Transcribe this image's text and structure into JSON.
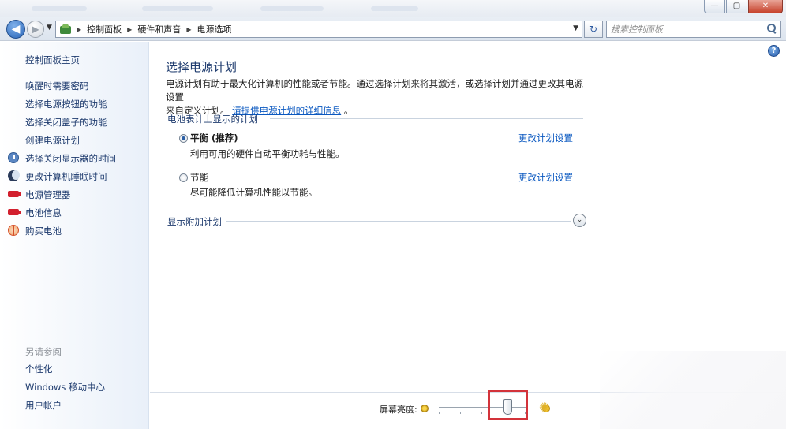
{
  "window": {
    "minimize_glyph": "—",
    "maximize_glyph": "▢",
    "close_glyph": "✕"
  },
  "nav": {
    "back_glyph": "◀",
    "forward_glyph": "▶",
    "dropdown_glyph": "▼",
    "breadcrumbs": [
      "控制面板",
      "硬件和声音",
      "电源选项"
    ],
    "breadcrumb_separator": "▶",
    "refresh_glyph": "↻",
    "search_placeholder": "搜索控制面板"
  },
  "sidebar": {
    "home": "控制面板主页",
    "links": [
      {
        "label": "唤醒时需要密码",
        "icon": ""
      },
      {
        "label": "选择电源按钮的功能",
        "icon": ""
      },
      {
        "label": "选择关闭盖子的功能",
        "icon": ""
      },
      {
        "label": "创建电源计划",
        "icon": ""
      },
      {
        "label": "选择关闭显示器的时间",
        "icon": "display-clock-icon"
      },
      {
        "label": "更改计算机睡眠时间",
        "icon": "moon-icon"
      },
      {
        "label": "电源管理器",
        "icon": "battery-icon"
      },
      {
        "label": "电池信息",
        "icon": "battery-icon"
      },
      {
        "label": "购买电池",
        "icon": "globe-icon"
      }
    ],
    "see_also_title": "另请参阅",
    "see_also": [
      "个性化",
      "Windows 移动中心",
      "用户帐户"
    ]
  },
  "main": {
    "help_glyph": "?",
    "title": "选择电源计划",
    "description_line1": "电源计划有助于最大化计算机的性能或者节能。通过选择计划来将其激活，或选择计划并通过更改其电源设置",
    "description_line2_prefix": "来自定义计划。",
    "description_link": "请提供电源计划的详细信息",
    "description_line2_suffix": "。",
    "section_label": "电池表计上显示的计划",
    "plans": [
      {
        "name": "平衡 (推荐)",
        "description": "利用可用的硬件自动平衡功耗与性能。",
        "selected": true,
        "link": "更改计划设置"
      },
      {
        "name": "节能",
        "description": "尽可能降低计算机性能以节能。",
        "selected": false,
        "link": "更改计划设置"
      }
    ],
    "more_plans_label": "显示附加计划",
    "expand_glyph": "⌄"
  },
  "brightness": {
    "label": "屏幕亮度:",
    "level_percent": 80
  },
  "colors": {
    "accent_link": "#0a58c0",
    "heading": "#1e3b6e",
    "highlight_box": "#d3333a"
  }
}
